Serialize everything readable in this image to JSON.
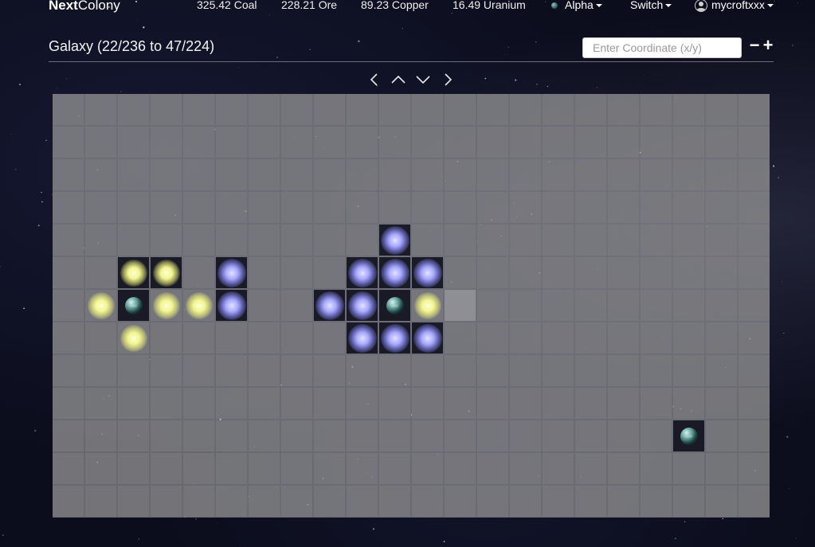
{
  "navbar": {
    "brand_bold": "Next",
    "brand_rest": "Colony",
    "resources": [
      {
        "label": "325.42 Coal"
      },
      {
        "label": "228.21 Ore"
      },
      {
        "label": "89.23 Copper"
      },
      {
        "label": "16.49 Uranium"
      }
    ],
    "planet_menu": {
      "label": "Alpha",
      "icon": "planet-icon"
    },
    "switch_menu": {
      "label": "Switch"
    },
    "user_menu": {
      "label": "mycroftxxx",
      "icon": "user-icon"
    }
  },
  "header": {
    "title": "Galaxy (22/236 to 47/224)",
    "coordinate_placeholder": "Enter Coordinate (x/y)",
    "zoom_out_label": "−",
    "zoom_in_label": "+"
  },
  "navigation": {
    "icons": [
      "chevron-left-icon",
      "chevron-up-icon",
      "chevron-down-icon",
      "chevron-right-icon"
    ]
  },
  "galaxy_map": {
    "columns": 22,
    "rows": 13,
    "cells": [
      {
        "row": 4,
        "col": 10,
        "type": "glow-blue",
        "dark": true
      },
      {
        "row": 5,
        "col": 2,
        "type": "glow-yellow",
        "dark": true
      },
      {
        "row": 5,
        "col": 3,
        "type": "glow-yellow",
        "dark": true
      },
      {
        "row": 5,
        "col": 5,
        "type": "glow-blue",
        "dark": true
      },
      {
        "row": 5,
        "col": 9,
        "type": "glow-blue",
        "dark": true
      },
      {
        "row": 5,
        "col": 10,
        "type": "glow-blue",
        "dark": true
      },
      {
        "row": 5,
        "col": 11,
        "type": "glow-blue",
        "dark": true
      },
      {
        "row": 6,
        "col": 1,
        "type": "glow-yellow",
        "dark": false
      },
      {
        "row": 6,
        "col": 2,
        "type": "planet",
        "dark": true
      },
      {
        "row": 6,
        "col": 3,
        "type": "glow-yellow",
        "dark": false
      },
      {
        "row": 6,
        "col": 4,
        "type": "glow-yellow",
        "dark": false
      },
      {
        "row": 6,
        "col": 5,
        "type": "glow-blue",
        "dark": true
      },
      {
        "row": 6,
        "col": 8,
        "type": "glow-blue",
        "dark": true
      },
      {
        "row": 6,
        "col": 9,
        "type": "glow-blue",
        "dark": true
      },
      {
        "row": 6,
        "col": 10,
        "type": "planet",
        "dark": true
      },
      {
        "row": 6,
        "col": 11,
        "type": "glow-yellow",
        "dark": false
      },
      {
        "row": 6,
        "col": 12,
        "type": "light",
        "dark": false
      },
      {
        "row": 7,
        "col": 2,
        "type": "glow-yellow",
        "dark": false
      },
      {
        "row": 7,
        "col": 9,
        "type": "glow-blue",
        "dark": true
      },
      {
        "row": 7,
        "col": 10,
        "type": "glow-blue",
        "dark": true
      },
      {
        "row": 7,
        "col": 11,
        "type": "glow-blue",
        "dark": true
      },
      {
        "row": 10,
        "col": 19,
        "type": "planet",
        "dark": true
      }
    ]
  }
}
